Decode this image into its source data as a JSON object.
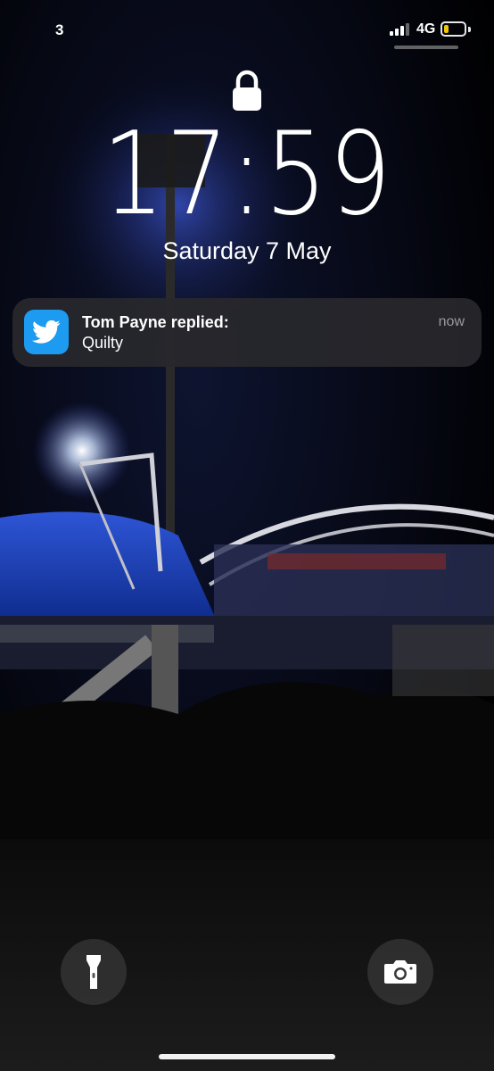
{
  "status_bar": {
    "carrier": "3",
    "network": "4G",
    "signal_bars": 3,
    "signal_total": 4,
    "battery_level": 0.25,
    "battery_color": "#f2c40c"
  },
  "lock_screen": {
    "lock_icon": "lock-icon",
    "time": "17:59",
    "date": "Saturday 7 May"
  },
  "notification": {
    "app_icon": "twitter-icon",
    "app_color": "#1d9bf0",
    "title": "Tom Payne replied:",
    "body": "Quilty",
    "time": "now"
  },
  "quick_actions": {
    "flashlight_icon": "flashlight-icon",
    "camera_icon": "camera-icon"
  },
  "wallpaper": {
    "description_icon": "stadium-night-wallpaper"
  }
}
